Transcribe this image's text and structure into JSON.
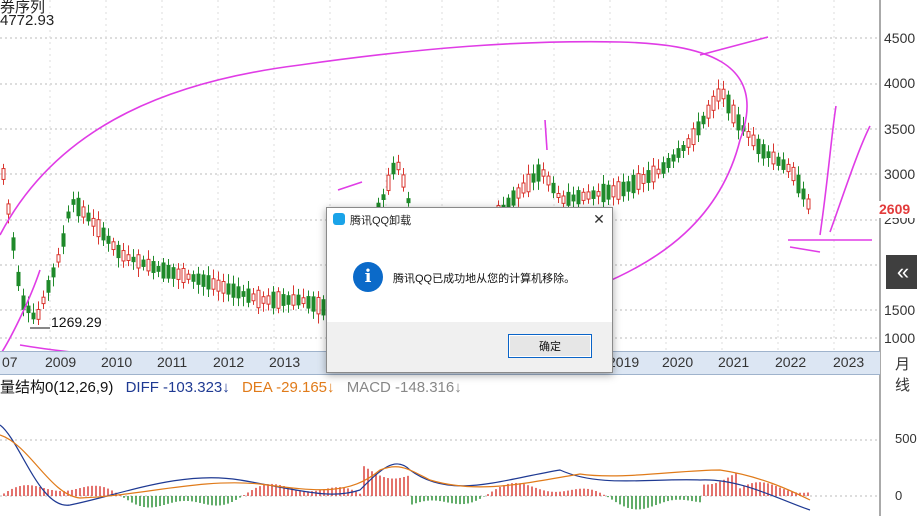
{
  "chart": {
    "series_title": "券序列",
    "high_value": "4772.93",
    "low_value": "1269.29",
    "last_price": "2609",
    "period_label": "月线",
    "y_ticks": [
      "4500",
      "4000",
      "3500",
      "3000",
      "2500",
      "1500",
      "1000"
    ],
    "x_labels": [
      "07",
      "2009",
      "2010",
      "2011",
      "2012",
      "2013",
      "2019",
      "2020",
      "2021",
      "2022",
      "2023"
    ],
    "collapse_icon": "«",
    "colors": {
      "up": "#d9362f",
      "down": "#1f8a2a",
      "annotation": "#e03ce6",
      "axis_band": "#dce6f3"
    }
  },
  "macd": {
    "name": "量结构0(12,26,9)",
    "diff": "DIFF -103.323↓",
    "dea": "DEA -29.165↓",
    "macd": "MACD -148.316↓",
    "ticks": [
      "500",
      "0"
    ],
    "colors": {
      "diff": "#1f3a93",
      "dea": "#e07b1a",
      "macd": "#888888"
    }
  },
  "dialog": {
    "title": "腾讯QQ卸载",
    "message": "腾讯QQ已成功地从您的计算机移除。",
    "ok_label": "确定",
    "close_label": "✕",
    "info_glyph": "i"
  },
  "chart_data": {
    "type": "candlestick",
    "series": [
      {
        "name": "price",
        "high": 4772.93,
        "low": 1269.29,
        "last": 2609
      },
      {
        "name": "DIFF",
        "last": -103.323
      },
      {
        "name": "DEA",
        "last": -29.165
      },
      {
        "name": "MACD",
        "last": -148.316
      }
    ],
    "x_labels": [
      "07",
      "2009",
      "2010",
      "2011",
      "2012",
      "2013",
      "2019",
      "2020",
      "2021",
      "2022",
      "2023"
    ],
    "ylim": [
      900,
      4700
    ],
    "grid": true
  }
}
